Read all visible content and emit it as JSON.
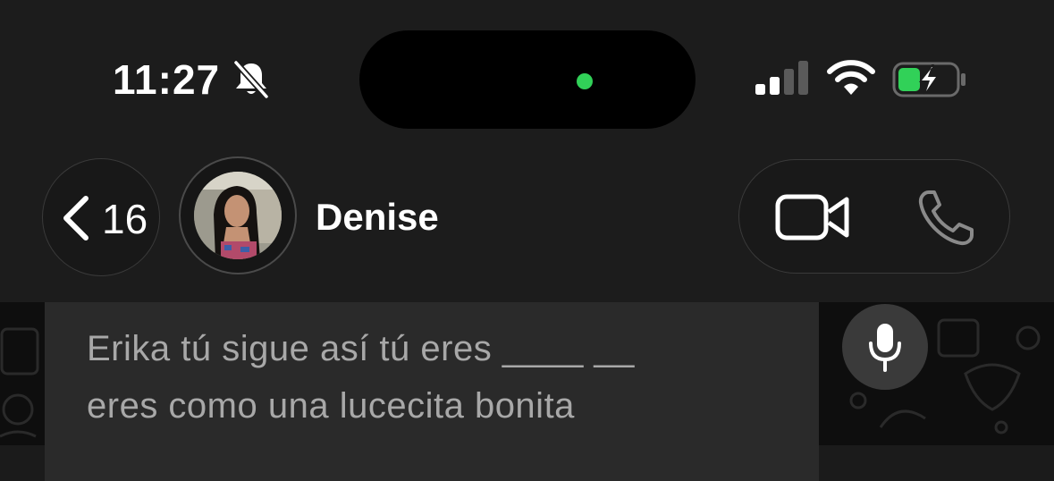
{
  "status_bar": {
    "time": "11:27",
    "icons": [
      "bell-slash-icon",
      "cellular-signal-icon",
      "wifi-icon",
      "battery-charging-icon"
    ],
    "battery_color": "#31d158"
  },
  "header": {
    "back": {
      "icon": "chevron-left-icon",
      "count": "16"
    },
    "contact": {
      "name": "Denise",
      "avatar": "avatar-photo"
    },
    "actions": {
      "video_icon": "video-camera-icon",
      "call_icon": "phone-icon"
    }
  },
  "chat": {
    "partial_message": "Erika tú sigue así tú eres ____ __\neres como una lucecita bonita",
    "mic_icon": "microphone-icon"
  },
  "colors": {
    "background": "#1c1c1c",
    "chat_background": "#0e0e0e",
    "bubble": "#2a2a2a",
    "accent_green": "#31d158"
  }
}
